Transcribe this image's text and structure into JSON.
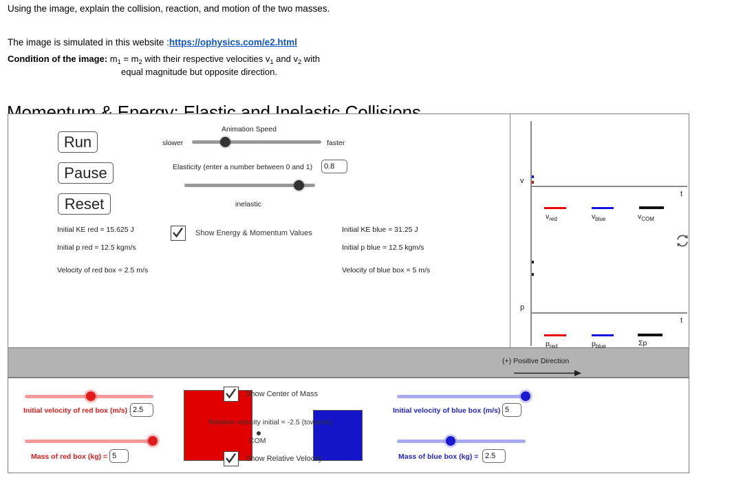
{
  "intro": {
    "line1": "Using the image, explain the collision, reaction, and motion of the two masses.",
    "line2_prefix": "The image is simulated in this website :",
    "link_text": "https://ophysics.com/e2.html",
    "condition_label": "Condition of the image:",
    "condition_text_a": " m",
    "condition_sub1": "1",
    "condition_text_b": " = m",
    "condition_sub2": "2",
    "condition_text_c": " with their respective velocities v",
    "condition_sub3": "1",
    "condition_text_d": " and v",
    "condition_sub4": "2",
    "condition_text_e": " with",
    "condition_line2": "equal magnitude but opposite direction."
  },
  "page_title": "Momentum & Energy: Elastic and Inelastic Collisions",
  "controls": {
    "run_label": "Run",
    "pause_label": "Pause",
    "reset_label": "Reset",
    "animation_speed_label": "Animation Speed",
    "slower_label": "slower",
    "faster_label": "faster",
    "elasticity_label": "Elasticity (enter a number between 0 and 1)",
    "elasticity_value": "0.8",
    "inelastic_label": "inelastic",
    "refresh_icon": "refresh-icon"
  },
  "checkboxes": {
    "show_energy_momentum": "Show Energy & Momentum Values",
    "show_center_of_mass": "Show Center of Mass",
    "show_relative_velocity": "Show Relative Velocity",
    "check_glyph": "check-icon"
  },
  "stats": {
    "red": {
      "initial_ke": "Initial KE red = 15.625 J",
      "initial_p": "Initial p red = 12.5 kgm/s",
      "velocity": "Velocity of red box = 2.5 m/s"
    },
    "blue": {
      "initial_ke": "Initial KE blue = 31.25 J",
      "initial_p": "Initial p blue = 12.5 kgm/s",
      "velocity": "Velocity of blue box = 5 m/s"
    },
    "relative_velocity": "Relative velocity initial = -2.5 (towards)"
  },
  "stage": {
    "com_label": "COM",
    "positive_direction": "(+) Positive Direction",
    "red_box_color": "#e00000",
    "blue_box_color": "#1414c8",
    "ground_color": "#b3b3b3"
  },
  "graphs": [
    {
      "y_axis": "v",
      "x_axis": "t",
      "legend": [
        {
          "key": "v",
          "sub": "red",
          "color": "#ee0000"
        },
        {
          "key": "v",
          "sub": "blue",
          "color": "#1414e0"
        },
        {
          "key": "v",
          "sub": "COM",
          "color": "#111111"
        }
      ]
    },
    {
      "y_axis": "p",
      "x_axis": "t",
      "legend": [
        {
          "key": "p",
          "sub": "red",
          "color": "#ee0000"
        },
        {
          "key": "p",
          "sub": "blue",
          "color": "#1414e0"
        },
        {
          "key": "Σp",
          "sub": "",
          "color": "#111111"
        }
      ]
    }
  ],
  "bottom": {
    "red_velocity_label": "Initial velocity of red box (m/s) =",
    "red_velocity_value": "2.5",
    "red_mass_label": "Mass of red box (kg) =",
    "red_mass_value": "5",
    "blue_velocity_label": "Initial velocity of blue box (m/s) =",
    "blue_velocity_value": "5",
    "blue_mass_label": "Mass of blue box (kg) =",
    "blue_mass_value": "2.5"
  }
}
